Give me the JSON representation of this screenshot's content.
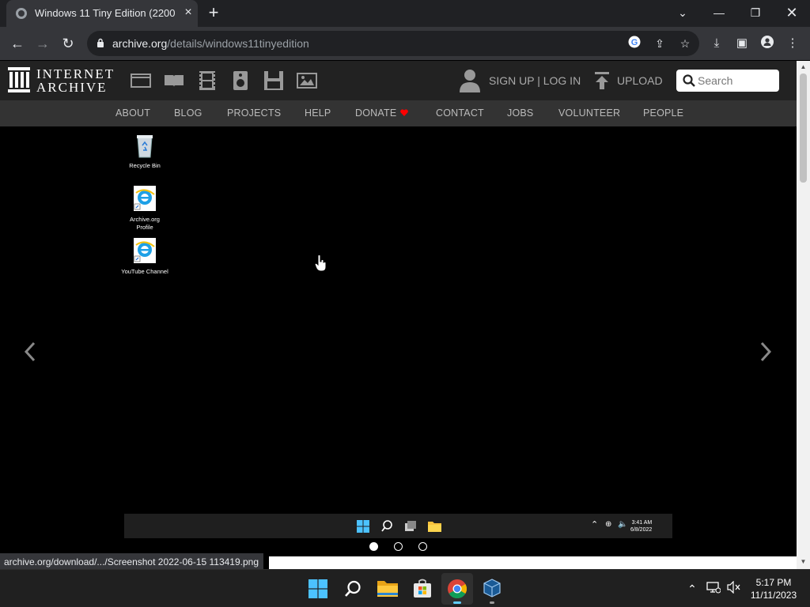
{
  "browser": {
    "tab_title": "Windows 11 Tiny Edition (22000",
    "url_host": "archive.org",
    "url_path": "/details/windows11tinyedition",
    "status_url": "archive.org/download/.../Screenshot 2022-06-15 113419.png"
  },
  "ia": {
    "logo_line1": "INTERNET",
    "logo_line2": "ARCHIVE",
    "signup_label": "SIGN UP | LOG IN",
    "upload_label": "UPLOAD",
    "search_placeholder": "Search",
    "nav": [
      "ABOUT",
      "BLOG",
      "PROJECTS",
      "HELP",
      "DONATE",
      "CONTACT",
      "JOBS",
      "VOLUNTEER",
      "PEOPLE"
    ],
    "media_icons": [
      "web-icon",
      "texts-icon",
      "video-icon",
      "audio-icon",
      "software-icon",
      "images-icon"
    ]
  },
  "viewer": {
    "desktop_icons": [
      {
        "label": "Recycle Bin",
        "icon": "recycle-bin-icon"
      },
      {
        "label": "Archive.org Profile",
        "icon": "internet-explorer-icon"
      },
      {
        "label": "YouTube Channel",
        "icon": "internet-explorer-icon"
      }
    ],
    "inner_clock_time": "3:41 AM",
    "inner_clock_date": "6/8/2022",
    "slide_count": 3,
    "active_slide": 1
  },
  "taskbar": {
    "apps": [
      "start-icon",
      "search-icon",
      "file-explorer-icon",
      "microsoft-store-icon",
      "chrome-icon",
      "virtualbox-icon"
    ],
    "time": "5:17 PM",
    "date": "11/11/2023"
  },
  "colors": {
    "accent_blue": "#60cdff",
    "ia_header": "#222222",
    "ia_nav": "#333333",
    "chrome_frame": "#202124",
    "chrome_toolbar": "#35363a",
    "donate_heart": "#ff0000"
  }
}
